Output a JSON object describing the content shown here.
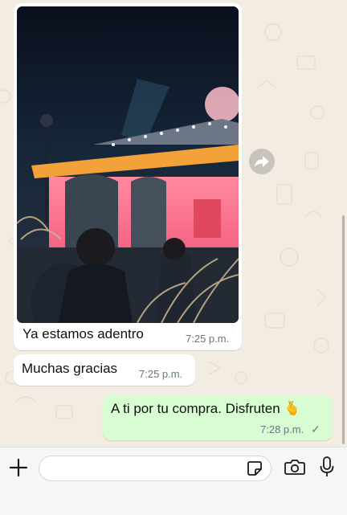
{
  "messages": [
    {
      "id": "m1",
      "direction": "incoming",
      "type": "image",
      "caption": "Ya estamos adentro",
      "time": "7:25 p.m."
    },
    {
      "id": "m2",
      "direction": "incoming",
      "type": "text",
      "text": "Muchas gracias",
      "time": "7:25 p.m."
    },
    {
      "id": "m3",
      "direction": "outgoing",
      "type": "text",
      "text": "A ti por tu compra. Disfruten 🫰",
      "time": "7:28 p.m.",
      "status": "✓"
    }
  ],
  "composer": {
    "placeholder": "",
    "icons": [
      "plus-icon",
      "sticker-icon",
      "camera-icon",
      "microphone-icon"
    ]
  },
  "icons": {
    "forward": "forward-arrow-icon"
  },
  "colors": {
    "chat_bg": "#f3ece3",
    "incoming_bubble": "#ffffff",
    "outgoing_bubble": "#d9fdd3",
    "timestamp": "#667781"
  }
}
